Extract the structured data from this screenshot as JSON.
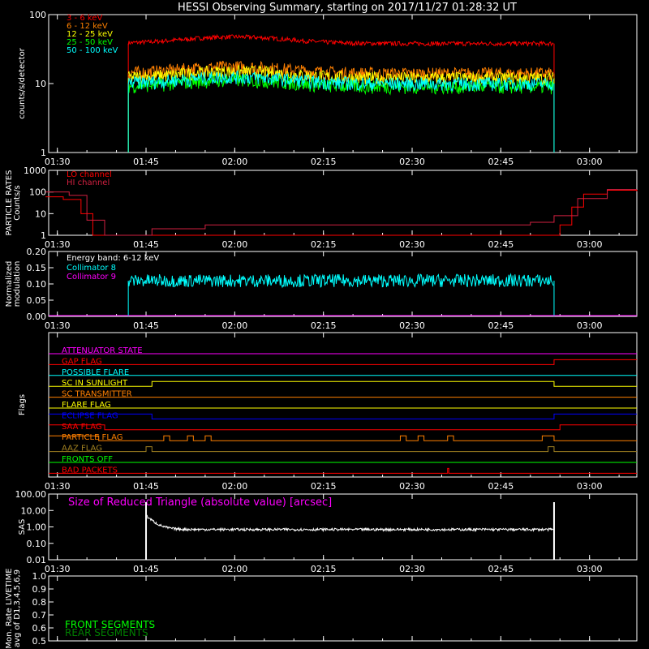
{
  "title": "HESSI Observing Summary, starting on 2017/11/27 01:28:32 UT",
  "time_ticks": [
    "01:30",
    "01:45",
    "02:00",
    "02:15",
    "02:30",
    "02:45",
    "03:00"
  ],
  "colors": {
    "red": "#ff0000",
    "orange": "#ff8000",
    "yellow": "#ffff00",
    "green": "#00ff00",
    "cyan": "#00ffff",
    "magenta": "#ff00ff",
    "blue": "#0000ff",
    "olive": "#a08020",
    "dark_green": "#008000",
    "white": "#ffffff"
  },
  "chart_data": [
    {
      "id": "count-rates",
      "type": "line",
      "ylabel": "counts/s/detector",
      "yscale": "log",
      "ylim": [
        1,
        100
      ],
      "ytick_labels": [
        "1",
        "10",
        "100"
      ],
      "x_unit": "time UT",
      "series": [
        {
          "name": "3 - 6 keV",
          "color": "#ff0000",
          "start": "01:42",
          "end": "02:54",
          "level": 38
        },
        {
          "name": "6 - 12 keV",
          "color": "#ff8000",
          "start": "01:42",
          "end": "02:54",
          "level": 14
        },
        {
          "name": "12 - 25 keV",
          "color": "#ffff00",
          "start": "01:42",
          "end": "02:54",
          "level": 12
        },
        {
          "name": "25 - 50 keV",
          "color": "#00ff00",
          "start": "01:42",
          "end": "02:54",
          "level": 9
        },
        {
          "name": "50 - 100 keV",
          "color": "#00ffff",
          "start": "01:42",
          "end": "02:54",
          "level": 10
        }
      ]
    },
    {
      "id": "particle-rates",
      "type": "line",
      "ylabel": "PARTICLE RATES Counts/s",
      "yscale": "log",
      "ylim": [
        1,
        1000
      ],
      "ytick_labels": [
        "1",
        "10",
        "100",
        "1000"
      ],
      "series": [
        {
          "name": "LO channel",
          "color": "#ff0000",
          "points": [
            [
              "01:28",
              60
            ],
            [
              "01:31",
              45
            ],
            [
              "01:34",
              10
            ],
            [
              "01:36",
              1
            ],
            [
              "02:00",
              1
            ],
            [
              "02:30",
              1
            ],
            [
              "02:53",
              1
            ],
            [
              "02:55",
              3
            ],
            [
              "02:57",
              20
            ],
            [
              "02:59",
              80
            ],
            [
              "03:03",
              120
            ],
            [
              "03:08",
              110
            ]
          ]
        },
        {
          "name": "HI channel",
          "color": "#d02040",
          "points": [
            [
              "01:28",
              100
            ],
            [
              "01:32",
              70
            ],
            [
              "01:35",
              5
            ],
            [
              "01:38",
              1
            ],
            [
              "01:46",
              2
            ],
            [
              "01:55",
              3
            ],
            [
              "02:15",
              3
            ],
            [
              "02:35",
              3
            ],
            [
              "02:50",
              4
            ],
            [
              "02:54",
              8
            ],
            [
              "02:58",
              50
            ],
            [
              "03:03",
              130
            ],
            [
              "03:08",
              130
            ]
          ]
        }
      ]
    },
    {
      "id": "modulation",
      "type": "line",
      "ylabel": "Normalized modulation",
      "ylim": [
        0.0,
        0.2
      ],
      "ytick_labels": [
        "0.00",
        "0.05",
        "0.10",
        "0.15",
        "0.20"
      ],
      "annotation": "Energy band: 6-12 keV",
      "series": [
        {
          "name": "Collimator 8",
          "color": "#00ffff",
          "start": "01:42",
          "end": "02:54",
          "level": 0.11
        },
        {
          "name": "Collimator 9",
          "color": "#ff00ff",
          "level": 0.0
        }
      ]
    },
    {
      "id": "flags",
      "type": "line",
      "ylabel": "Flags",
      "series": [
        {
          "name": "ATTENUATOR STATE",
          "color": "#ff00ff",
          "steps": [
            [
              "01:28",
              0
            ]
          ]
        },
        {
          "name": "GAP FLAG",
          "color": "#ff0000",
          "steps": [
            [
              "01:28",
              0
            ],
            [
              "02:54",
              1
            ]
          ]
        },
        {
          "name": "POSSIBLE FLARE",
          "color": "#00ffff",
          "steps": [
            [
              "01:28",
              0
            ]
          ]
        },
        {
          "name": "SC IN SUNLIGHT",
          "color": "#ffff00",
          "steps": [
            [
              "01:28",
              0
            ],
            [
              "01:46",
              1
            ],
            [
              "02:54",
              0
            ]
          ]
        },
        {
          "name": "SC TRANSMITTER",
          "color": "#ff8000",
          "steps": [
            [
              "01:28",
              0
            ]
          ]
        },
        {
          "name": "FLARE FLAG",
          "color": "#ffff00",
          "steps": [
            [
              "01:28",
              0
            ]
          ]
        },
        {
          "name": "ECLIPSE FLAG",
          "color": "#0000ff",
          "steps": [
            [
              "01:28",
              1
            ],
            [
              "01:46",
              0
            ],
            [
              "02:54",
              1
            ]
          ]
        },
        {
          "name": "SAA FLAG",
          "color": "#ff0000",
          "steps": [
            [
              "01:28",
              1
            ],
            [
              "01:38",
              0
            ],
            [
              "02:55",
              1
            ]
          ]
        },
        {
          "name": "PARTICLE FLAG",
          "color": "#ff8000",
          "steps": [
            [
              "01:28",
              1
            ],
            [
              "01:37",
              0
            ],
            [
              "01:48",
              1
            ],
            [
              "01:49",
              0
            ],
            [
              "01:52",
              1
            ],
            [
              "01:53",
              0
            ],
            [
              "01:55",
              1
            ],
            [
              "01:56",
              0
            ],
            [
              "02:28",
              1
            ],
            [
              "02:29",
              0
            ],
            [
              "02:31",
              1
            ],
            [
              "02:32",
              0
            ],
            [
              "02:36",
              1
            ],
            [
              "02:37",
              0
            ],
            [
              "02:52",
              1
            ],
            [
              "02:54",
              0
            ]
          ]
        },
        {
          "name": "AAZ FLAG",
          "color": "#a08020",
          "steps": [
            [
              "01:28",
              0
            ],
            [
              "01:45",
              1
            ],
            [
              "01:46",
              0
            ],
            [
              "02:53",
              1
            ],
            [
              "02:54",
              0
            ]
          ]
        },
        {
          "name": "FRONTS OFF",
          "color": "#00ff00",
          "steps": [
            [
              "01:28",
              0
            ]
          ]
        },
        {
          "name": "BAD PACKETS",
          "color": "#ff0000",
          "steps": [
            [
              "01:28",
              0
            ],
            [
              "02:36",
              1
            ],
            [
              "02:36.2",
              0
            ]
          ]
        }
      ]
    },
    {
      "id": "sas",
      "type": "line",
      "ylabel": "SAS",
      "yscale": "log",
      "ylim": [
        0.01,
        100
      ],
      "ytick_labels": [
        "0.01",
        "0.10",
        "1.00",
        "10.00",
        "100.00"
      ],
      "annotation": "Size of Reduced Triangle (absolute value) [arcsec]",
      "series": [
        {
          "name": "Size of Reduced Triangle",
          "color": "#ffffff",
          "start": "01:45",
          "end": "02:54",
          "level": 0.7
        }
      ]
    },
    {
      "id": "livetime",
      "type": "line",
      "ylabel": "Mon. Rate LIVETIME avg of D1,3,4,5,6,9",
      "ylim": [
        0.5,
        1.0
      ],
      "ytick_labels": [
        "0.5",
        "0.6",
        "0.7",
        "0.8",
        "0.9",
        "1.0"
      ],
      "series": [
        {
          "name": "FRONT SEGMENTS",
          "color": "#00ff00"
        },
        {
          "name": "REAR SEGMENTS",
          "color": "#008000"
        }
      ]
    }
  ]
}
